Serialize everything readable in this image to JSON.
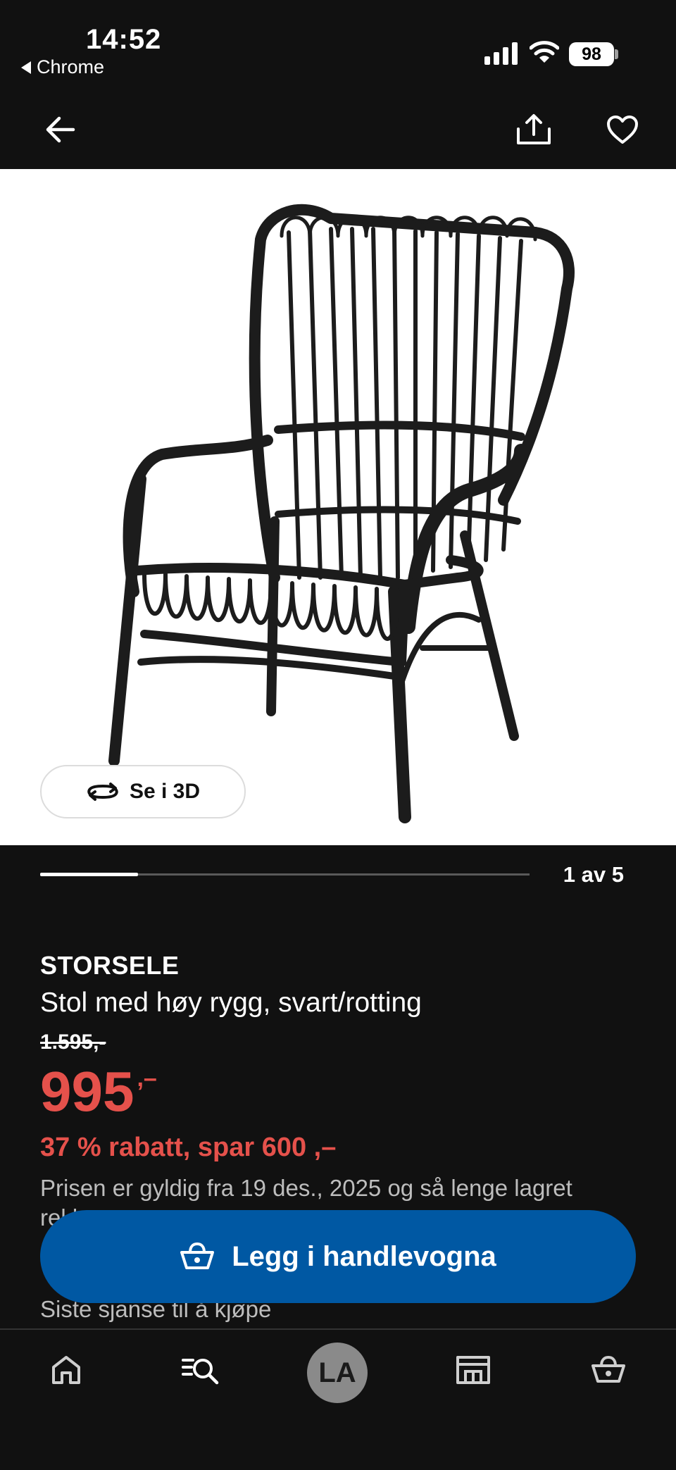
{
  "status_bar": {
    "time": "14:52",
    "back_app": "Chrome",
    "battery": "98"
  },
  "nav": {
    "back_icon": "arrow-left-icon",
    "share_icon": "share-icon",
    "favorite_icon": "heart-icon"
  },
  "gallery": {
    "see_3d_label": "Se i 3D",
    "counter": "1 av 5",
    "current": 1,
    "total": 5
  },
  "product": {
    "brand": "STORSELE",
    "description": "Stol med høy rygg, svart/rotting",
    "old_price": "1.595,-",
    "price": "995",
    "price_suffix": ",–",
    "discount": "37 % rabatt, spar 600 ,–",
    "validity": "Prisen er gyldig fra 19 des., 2025 og så lenge lagret rekker",
    "last_chance": "Siste sjanse til å kjøpe"
  },
  "cart_button": {
    "label": "Legg i handlevogna"
  },
  "bottom_nav": {
    "avatar_initials": "LA",
    "items": [
      "home-icon",
      "search-list-icon",
      "avatar",
      "store-icon",
      "basket-icon"
    ]
  },
  "colors": {
    "background": "#111111",
    "accent_red": "#e5514b",
    "primary_blue": "#0058a3"
  }
}
